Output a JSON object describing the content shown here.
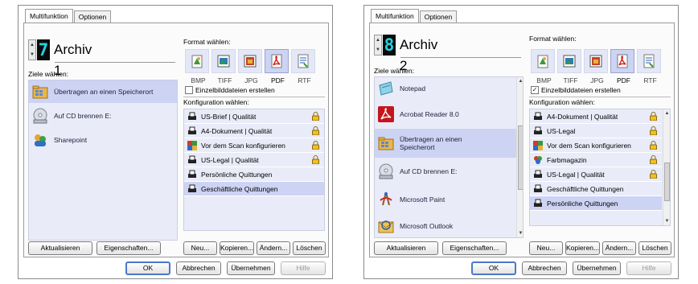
{
  "tabs": [
    "Multifunktion",
    "Optionen"
  ],
  "left": {
    "digit": "7",
    "archive": "Archiv 1",
    "destinations_label": "Ziele wählen:",
    "destinations": [
      {
        "label": "Übertragen an einen Speicherort",
        "icon": "folder-icon",
        "selected": true
      },
      {
        "label": "Auf CD brennen  E:",
        "icon": "cd-drive-icon",
        "selected": false
      },
      {
        "label": "Sharepoint",
        "icon": "sharepoint-icon",
        "selected": false
      }
    ],
    "format_label": "Format wählen:",
    "formats": [
      {
        "label": "BMP",
        "icon": "bmp-icon",
        "selected": false
      },
      {
        "label": "TIFF",
        "icon": "tiff-icon",
        "selected": false
      },
      {
        "label": "JPG",
        "icon": "jpg-icon",
        "selected": false
      },
      {
        "label": "PDF",
        "icon": "pdf-icon",
        "selected": true
      },
      {
        "label": "RTF",
        "icon": "rtf-icon",
        "selected": false
      }
    ],
    "single_files": {
      "label": "Einzelbilddateien erstellen",
      "checked": false
    },
    "config_label": "Konfiguration wählen:",
    "configs": [
      {
        "label": "US-Brief | Qualität",
        "icon": "scanner-icon",
        "locked": true,
        "selected": false
      },
      {
        "label": "A4-Dokument | Qualität",
        "icon": "scanner-icon",
        "locked": true,
        "selected": false
      },
      {
        "label": "Vor dem Scan konfigurieren",
        "icon": "configure-icon",
        "locked": true,
        "selected": false
      },
      {
        "label": "US-Legal | Qualität",
        "icon": "scanner-icon",
        "locked": true,
        "selected": false
      },
      {
        "label": "Persönliche Quittungen",
        "icon": "scanner-icon",
        "locked": false,
        "selected": false
      },
      {
        "label": "Geschäftliche Quittungen",
        "icon": "scanner-icon",
        "locked": false,
        "selected": true
      }
    ]
  },
  "right": {
    "digit": "8",
    "archive": "Archiv 2",
    "destinations_label": "Ziele wählen:",
    "destinations": [
      {
        "label": "Notepad",
        "icon": "notepad-icon",
        "selected": false
      },
      {
        "label": "Acrobat Reader 8.0",
        "icon": "acrobat-icon",
        "selected": false
      },
      {
        "label": "Übertragen an einen Speicherort",
        "icon": "folder-icon",
        "selected": true
      },
      {
        "label": "Auf CD brennen  E:",
        "icon": "cd-drive-icon",
        "selected": false
      },
      {
        "label": "Microsoft Paint",
        "icon": "paint-icon",
        "selected": false
      },
      {
        "label": "Microsoft Outlook",
        "icon": "outlook-icon",
        "selected": false
      }
    ],
    "format_label": "Format wählen:",
    "formats": [
      {
        "label": "BMP",
        "icon": "bmp-icon",
        "selected": false
      },
      {
        "label": "TIFF",
        "icon": "tiff-icon",
        "selected": false
      },
      {
        "label": "JPG",
        "icon": "jpg-icon",
        "selected": false
      },
      {
        "label": "PDF",
        "icon": "pdf-icon",
        "selected": true
      },
      {
        "label": "RTF",
        "icon": "rtf-icon",
        "selected": false
      }
    ],
    "single_files": {
      "label": "Einzelbilddateien erstellen",
      "checked": true
    },
    "config_label": "Konfiguration wählen:",
    "configs": [
      {
        "label": "A4-Dokument | Qualität",
        "icon": "scanner-icon",
        "locked": true,
        "selected": false
      },
      {
        "label": "US-Legal",
        "icon": "scanner-icon",
        "locked": true,
        "selected": false
      },
      {
        "label": "Vor dem Scan konfigurieren",
        "icon": "configure-icon",
        "locked": true,
        "selected": false
      },
      {
        "label": "Farbmagazin",
        "icon": "color-icon",
        "locked": true,
        "selected": false
      },
      {
        "label": "US-Legal | Qualität",
        "icon": "scanner-icon",
        "locked": true,
        "selected": false
      },
      {
        "label": "Geschäftliche Quittungen",
        "icon": "scanner-icon",
        "locked": false,
        "selected": false
      },
      {
        "label": "Persönliche Quittungen",
        "icon": "scanner-icon",
        "locked": false,
        "selected": true
      }
    ]
  },
  "buttons": {
    "refresh": "Aktualisieren",
    "properties": "Eigenschaften...",
    "new": "Neu...",
    "copy": "Kopieren...",
    "edit": "Ändern...",
    "delete": "Löschen",
    "ok": "OK",
    "cancel": "Abbrechen",
    "apply": "Übernehmen",
    "help": "Hilfe"
  },
  "colors": {
    "list_bg": "#e9ecf8",
    "selection": "#cdd3f3",
    "digit_bg": "#0a0a0a",
    "digit_fg": "#21d4e0"
  }
}
